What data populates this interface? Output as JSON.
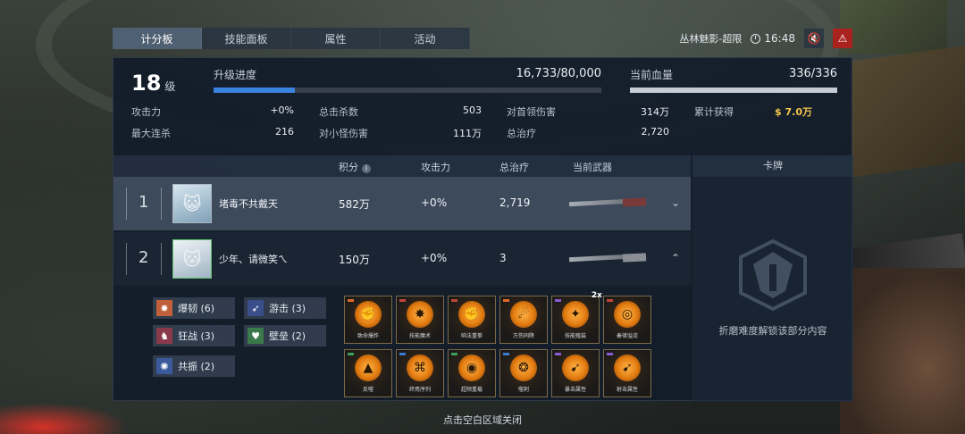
{
  "tabs": [
    {
      "label": "计分板",
      "active": true
    },
    {
      "label": "技能面板",
      "active": false
    },
    {
      "label": "属性",
      "active": false
    },
    {
      "label": "活动",
      "active": false
    }
  ],
  "topbar": {
    "mode": "丛林魅影-超限",
    "time": "16:48",
    "mute_icon": "speaker-muted-icon",
    "warning_icon": "warning-icon"
  },
  "level": {
    "value": "18",
    "unit": "级"
  },
  "upgrade": {
    "label": "升级进度",
    "value": "16,733/80,000",
    "progress": 0.209
  },
  "health": {
    "label": "当前血量",
    "value": "336/336",
    "progress": 1.0
  },
  "stats": {
    "attack": {
      "label": "攻击力",
      "value": "+0%"
    },
    "total_kills": {
      "label": "总击杀数",
      "value": "503"
    },
    "boss_damage": {
      "label": "对首领伤害",
      "value": "314万"
    },
    "total_gain": {
      "label": "累计获得",
      "value": "7.0万"
    },
    "max_combo": {
      "label": "最大连杀",
      "value": "216"
    },
    "minion_damage": {
      "label": "对小怪伤害",
      "value": "111万"
    },
    "total_heal": {
      "label": "总治疗",
      "value": "2,720"
    }
  },
  "table": {
    "headers": {
      "score": "积分",
      "attack": "攻击力",
      "heal": "总治疗",
      "weapon": "当前武器",
      "cards": "卡牌"
    },
    "rows": [
      {
        "rank": "1",
        "name": "堵毒不共戴天",
        "score": "582万",
        "attack": "+0%",
        "heal": "2,719",
        "avatar": "anime-avatar-icon",
        "expanded": false
      },
      {
        "rank": "2",
        "name": "少年、请微笑ㄟ",
        "score": "150万",
        "attack": "+0%",
        "heal": "3",
        "avatar": "cat-avatar-icon",
        "expanded": true
      }
    ]
  },
  "badges": [
    {
      "label": "爆韧 (6)",
      "icon": "burst-icon",
      "color": "#c0603a"
    },
    {
      "label": "游击 (3)",
      "icon": "guerrilla-icon",
      "color": "#3a4e8a"
    },
    {
      "label": "狂战 (3)",
      "icon": "berserk-icon",
      "color": "#8a3a4a"
    },
    {
      "label": "壁垒 (2)",
      "icon": "barrier-icon",
      "color": "#3a7a4a"
    },
    {
      "label": "共振 (2)",
      "icon": "resonance-icon",
      "color": "#3a5a9a"
    }
  ],
  "skills": [
    {
      "label": "致命爆炸",
      "glyph": "✊",
      "dot": "#e06a2a"
    },
    {
      "label": "技能魔术",
      "glyph": "✸",
      "dot": "#c0483a"
    },
    {
      "label": "响法重拳",
      "glyph": "✊",
      "dot": "#c0483a"
    },
    {
      "label": "万伤同降",
      "glyph": "☄",
      "dot": "#e06a2a"
    },
    {
      "label": "技能殖装",
      "glyph": "✦",
      "dot": "#8a5ad0",
      "mult": "2x"
    },
    {
      "label": "秦律溢流",
      "glyph": "◎",
      "dot": "#c0483a"
    },
    {
      "label": "反噬",
      "glyph": "▲",
      "dot": "#3aa05a"
    },
    {
      "label": "终焉序列",
      "glyph": "⌘",
      "dot": "#3a7ad0"
    },
    {
      "label": "超频重载",
      "glyph": "◉",
      "dot": "#3aa05a"
    },
    {
      "label": "噬刺",
      "glyph": "❂",
      "dot": "#3a7ad0"
    },
    {
      "label": "暴击属性",
      "glyph": "➹",
      "dot": "#8a5ad0"
    },
    {
      "label": "射击属性",
      "glyph": "➹",
      "dot": "#8a5ad0"
    }
  ],
  "cards": {
    "locked_text": "折磨难度解锁该部分内容"
  },
  "footer": "点击空白区域关闭"
}
